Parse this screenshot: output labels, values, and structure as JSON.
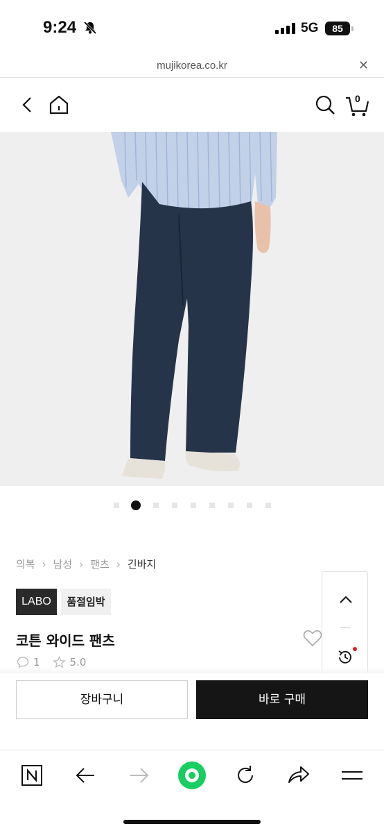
{
  "status_bar": {
    "time": "9:24",
    "network": "5G",
    "battery": "85",
    "icons": [
      "bell-muted-icon",
      "signal-icon",
      "battery-icon"
    ]
  },
  "browser": {
    "url": "mujikorea.co.kr",
    "close_icon": "close-icon"
  },
  "header": {
    "icons": [
      "back-icon",
      "home-icon",
      "search-icon",
      "cart-icon"
    ],
    "cart_count": "0"
  },
  "gallery": {
    "total_slides": 9,
    "active_slide": 2
  },
  "breadcrumb": {
    "items": [
      "의복",
      "남성",
      "팬츠",
      "긴바지"
    ]
  },
  "product": {
    "badge_labo": "LABO",
    "badge_status": "품절임박",
    "title": "코튼 와이드 팬츠",
    "review_count": "1",
    "rating": "5.0"
  },
  "actions": {
    "cart_label": "장바구니",
    "buy_label": "바로 구매"
  },
  "toolbar": {
    "icons": [
      "naver-n-icon",
      "back-arrow-icon",
      "forward-arrow-icon",
      "green-home-icon",
      "reload-icon",
      "share-icon",
      "menu-icon"
    ]
  },
  "colors": {
    "accent_green": "#19ce60",
    "buy_button": "#151515",
    "alert_dot": "#d32222"
  }
}
